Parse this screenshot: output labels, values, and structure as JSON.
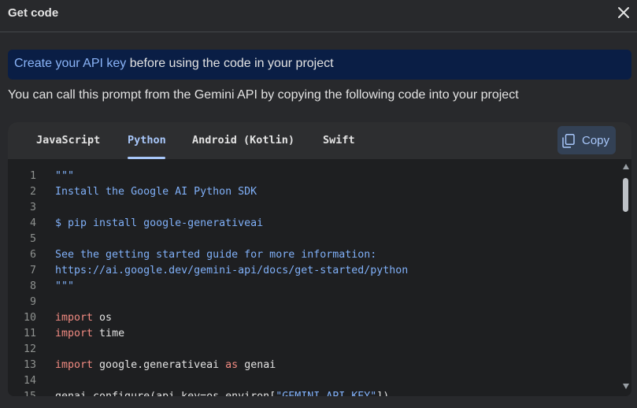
{
  "dialog": {
    "title": "Get code",
    "close_icon": "close-icon"
  },
  "banner": {
    "link": "Create your API key",
    "text": " before using the code in your project"
  },
  "description": "You can call this prompt from the Gemini API by copying the following code into your project",
  "tabs": [
    "JavaScript",
    "Python",
    "Android (Kotlin)",
    "Swift"
  ],
  "active_tab": "Python",
  "copy_button": {
    "label": "Copy",
    "icon": "copy-icon"
  },
  "code_lines": [
    {
      "n": "1",
      "parts": [
        {
          "t": "\"\"\"",
          "c": "str"
        }
      ]
    },
    {
      "n": "2",
      "parts": [
        {
          "t": "Install the Google AI Python SDK",
          "c": "str"
        }
      ]
    },
    {
      "n": "3",
      "parts": []
    },
    {
      "n": "4",
      "parts": [
        {
          "t": "$ pip install google-generativeai",
          "c": "str"
        }
      ]
    },
    {
      "n": "5",
      "parts": []
    },
    {
      "n": "6",
      "parts": [
        {
          "t": "See the getting started guide for more information:",
          "c": "str"
        }
      ]
    },
    {
      "n": "7",
      "parts": [
        {
          "t": "https://ai.google.dev/gemini-api/docs/get-started/python",
          "c": "str"
        }
      ]
    },
    {
      "n": "8",
      "parts": [
        {
          "t": "\"\"\"",
          "c": "str"
        }
      ]
    },
    {
      "n": "9",
      "parts": []
    },
    {
      "n": "10",
      "parts": [
        {
          "t": "import",
          "c": "kw"
        },
        {
          "t": " os",
          "c": "tx"
        }
      ]
    },
    {
      "n": "11",
      "parts": [
        {
          "t": "import",
          "c": "kw"
        },
        {
          "t": " time",
          "c": "tx"
        }
      ]
    },
    {
      "n": "12",
      "parts": []
    },
    {
      "n": "13",
      "parts": [
        {
          "t": "import",
          "c": "kw"
        },
        {
          "t": " google.generativeai ",
          "c": "tx"
        },
        {
          "t": "as",
          "c": "kw"
        },
        {
          "t": " genai",
          "c": "tx"
        }
      ]
    },
    {
      "n": "14",
      "parts": []
    },
    {
      "n": "15",
      "parts": [
        {
          "t": "genai.configure(api_key=os.environ[",
          "c": "tx"
        },
        {
          "t": "\"GEMINI_API_KEY\"",
          "c": "str2"
        },
        {
          "t": "])",
          "c": "tx"
        }
      ]
    }
  ]
}
